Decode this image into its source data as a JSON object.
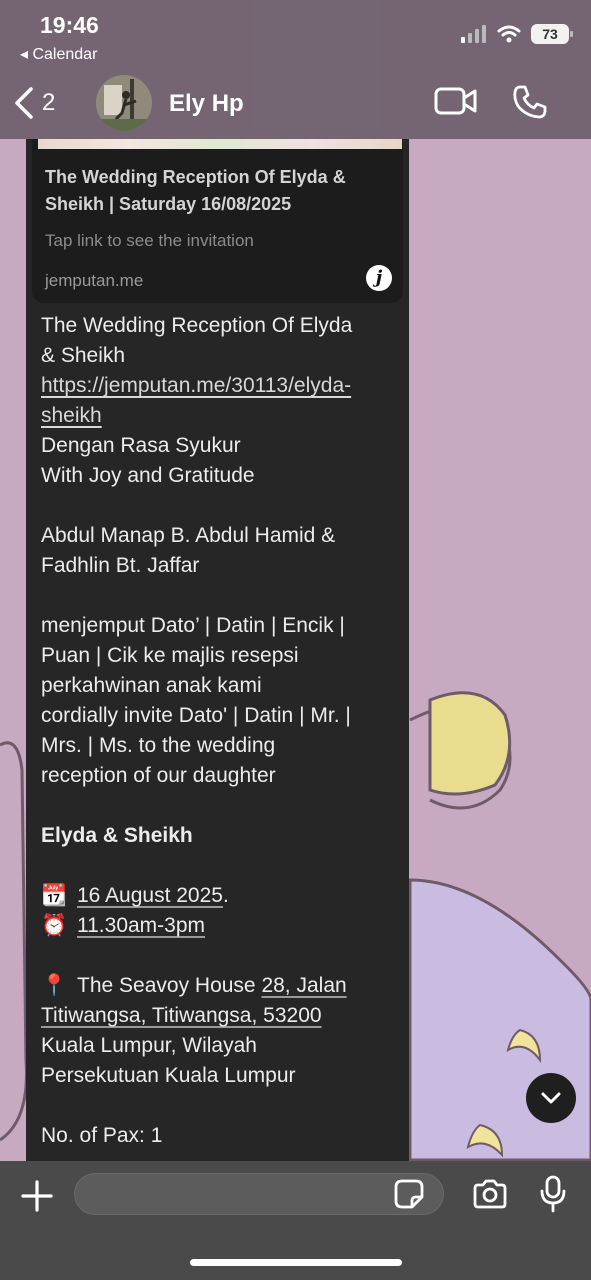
{
  "status_bar": {
    "time": "19:46",
    "back_app": "◂ Calendar",
    "battery": "73"
  },
  "header": {
    "back_count": "2",
    "contact_name": "Ely Hp",
    "icons": [
      "chevron-left-icon",
      "video-camera-icon",
      "phone-icon"
    ]
  },
  "link_preview": {
    "title": "The Wedding Reception Of Elyda & Sheikh | Saturday 16/08/2025",
    "description": "Tap link to see the invitation",
    "domain": "jemputan.me",
    "badge": "j"
  },
  "message": {
    "title_line1": "The Wedding Reception Of Elyda",
    "title_line2": "& Sheikh",
    "link_line1": "https://jemputan.me/30113/elyda-",
    "link_line2": "sheikh",
    "malay_greeting": "Dengan Rasa Syukur",
    "english_greeting": "With Joy and Gratitude",
    "parents_line1": "Abdul Manap B. Abdul Hamid &",
    "parents_line2": "Fadhlin Bt. Jaffar",
    "invite_ms_line1": "menjemput Dato’ | Datin | Encik |",
    "invite_ms_line2": "Puan | Cik ke majlis resepsi",
    "invite_ms_line3": "perkahwinan anak kami",
    "invite_en_line1": "cordially invite Dato' | Datin | Mr. |",
    "invite_en_line2": "Mrs. | Ms. to the wedding",
    "invite_en_line3": "reception of our daughter",
    "couple": "Elyda & Sheikh",
    "date": "16 August 2025",
    "date_suffix": ".",
    "time": "11.30am-3pm",
    "venue_name": "The Seavoy House",
    "address_part1": "28, Jalan",
    "address_part2": "Titiwangsa, Titiwangsa, 53200",
    "address_line3": "Kuala Lumpur, Wilayah",
    "address_line4": "Persekutuan Kuala Lumpur",
    "pax": "No. of Pax: 1",
    "emojis": {
      "calendar": "📆",
      "alarm": "⏰",
      "pin": "📍"
    }
  },
  "composer": {
    "placeholder": "",
    "icons": [
      "plus-icon",
      "sticker-icon",
      "camera-icon",
      "microphone-icon",
      "chevron-down-icon"
    ]
  },
  "colors": {
    "bubble": "#262626",
    "header": "#6e606c",
    "wallpaper": "#c7a9c2",
    "bottombar": "#4a4a4a"
  }
}
